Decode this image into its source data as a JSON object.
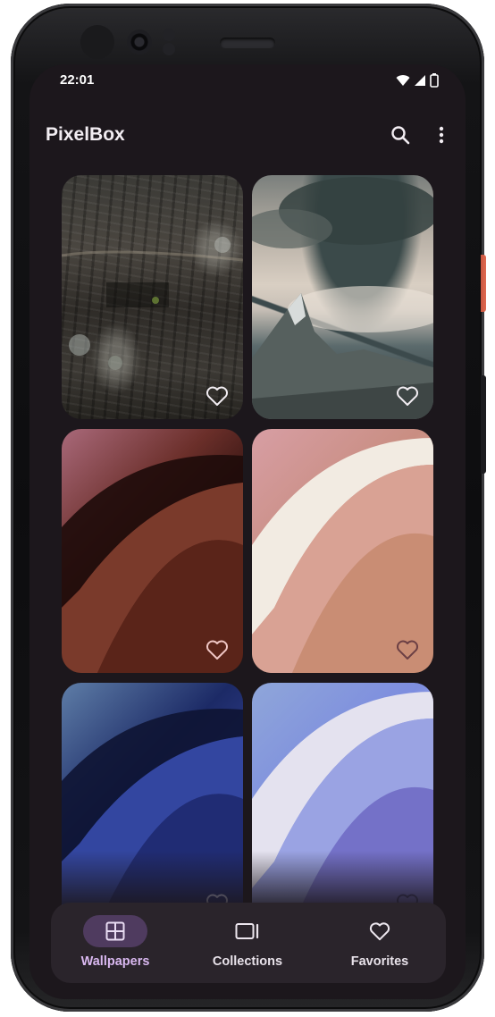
{
  "status_bar": {
    "time": "22:01",
    "icons": [
      "wifi-icon",
      "cellular-icon",
      "battery-icon"
    ]
  },
  "app_bar": {
    "title": "PixelBox",
    "actions": [
      "search-icon",
      "more-vert-icon"
    ]
  },
  "wallpapers": [
    {
      "id": "tile-1",
      "favorite": false
    },
    {
      "id": "tile-2",
      "favorite": false
    },
    {
      "id": "tile-3",
      "favorite": false
    },
    {
      "id": "tile-4",
      "favorite": false
    },
    {
      "id": "tile-5",
      "favorite": false
    },
    {
      "id": "tile-6",
      "favorite": false
    }
  ],
  "bottom_nav": {
    "items": [
      {
        "label": "Wallpapers",
        "icon": "grid-icon",
        "active": true
      },
      {
        "label": "Collections",
        "icon": "collections-icon",
        "active": false
      },
      {
        "label": "Favorites",
        "icon": "heart-icon",
        "active": false
      }
    ]
  },
  "colors": {
    "accent": "#d9b8f0",
    "active_pill": "#4f3b5f",
    "background": "#1c171c",
    "nav_background": "#2a242b"
  }
}
